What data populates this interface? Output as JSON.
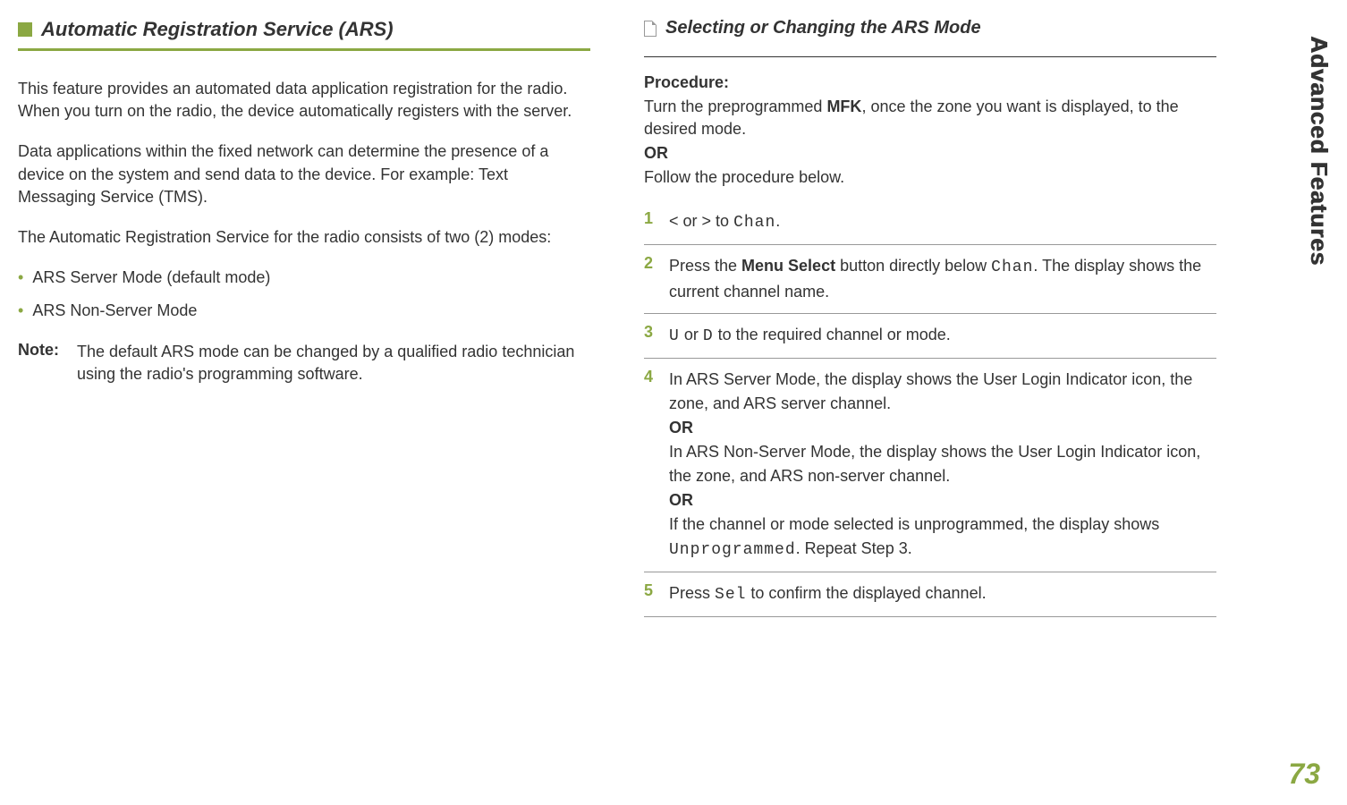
{
  "side_title": "Advanced Features",
  "page_number": "73",
  "left": {
    "title": "Automatic Registration Service (ARS)",
    "p1": "This feature provides an automated data application registration for the radio. When you turn on the radio, the device automatically registers with the server.",
    "p2": "Data applications within the fixed network can determine the presence of a device on the system and send data to the device. For example: Text Messaging Service (TMS).",
    "p3": "The Automatic Registration Service for the radio consists of two (2) modes:",
    "bullets": [
      "ARS Server Mode (default mode)",
      "ARS Non-Server Mode"
    ],
    "note_label": "Note:",
    "note_text": "The default ARS mode can be changed by a qualified radio technician using the radio's programming software."
  },
  "right": {
    "title": "Selecting or Changing the ARS Mode",
    "proc_label": "Procedure:",
    "proc1a": "Turn the preprogrammed ",
    "proc1_mfk": "MFK",
    "proc1b": ", once the zone you want is displayed, to the desired mode.",
    "or": "OR",
    "proc2": "Follow the procedure below.",
    "steps": {
      "s1a": "< ",
      "s1b": "or",
      "s1c": " > ",
      "s1d": "to ",
      "s1_chan": "Chan",
      "s1e": ".",
      "s2a": "Press the ",
      "s2_menu": "Menu Select",
      "s2b": " button directly below ",
      "s2_chan": "Chan",
      "s2c": ". The display shows the current channel name.",
      "s3a": "U",
      "s3b": " or ",
      "s3c": "D",
      "s3d": " to the required channel or mode.",
      "s4a": "In ARS Server Mode, the display shows the User Login Indicator icon, the zone, and ARS server channel.",
      "s4_or1": "OR",
      "s4b": "In ARS Non-Server Mode, the display shows the User Login Indicator icon, the zone, and ARS non-server channel.",
      "s4_or2": "OR",
      "s4c1": "If the channel or mode selected is unprogrammed, the display shows ",
      "s4_unp": "Unprogrammed",
      "s4c2": ". Repeat Step 3.",
      "s5a": "Press ",
      "s5_sel": "Sel",
      "s5b": " to confirm the displayed channel."
    }
  }
}
